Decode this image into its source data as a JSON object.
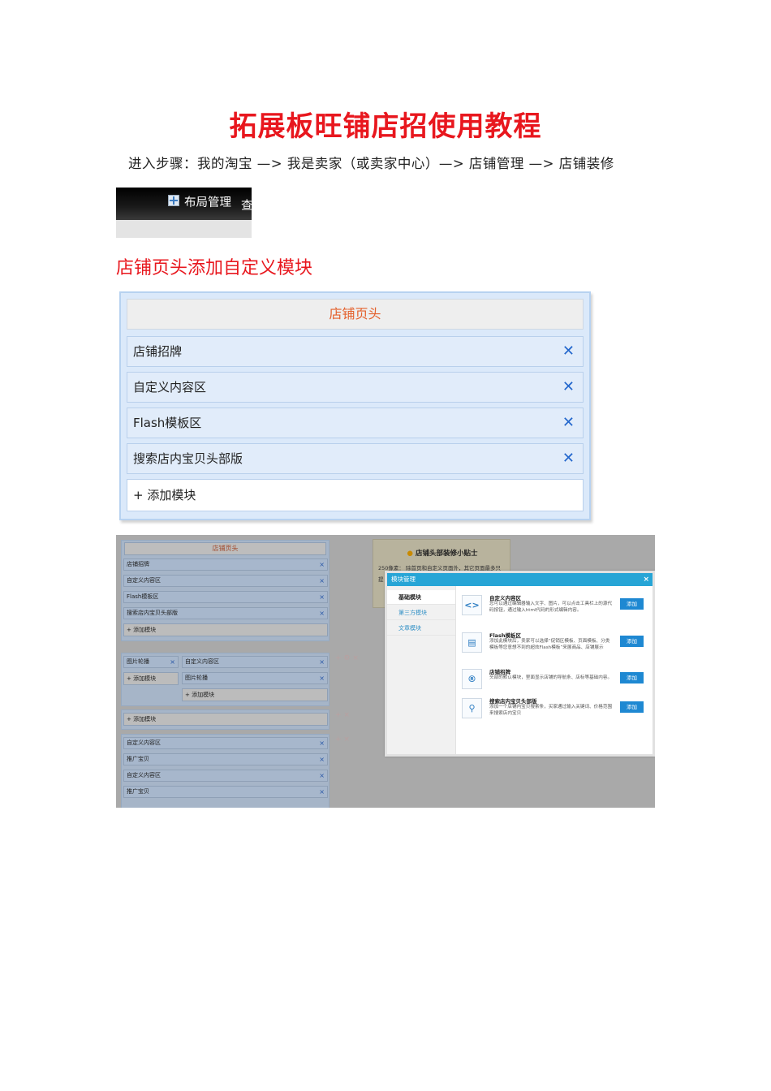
{
  "doc_title": "拓展板旺铺店招使用教程",
  "steps": "进入步骤：我的淘宝 —> 我是卖家（或卖家中心）—> 店铺管理 —> 店铺装修",
  "toolbar": {
    "layout_label": "布局管理",
    "cut_label": "查"
  },
  "section_heading": "店铺页头添加自定义模块",
  "panel": {
    "header": "店铺页头",
    "rows": [
      "店铺招牌",
      "自定义内容区",
      "Flash模板区",
      "搜索店内宝贝头部版"
    ],
    "remove_symbol": "✕",
    "add_label": "+ 添加模块"
  },
  "screenshot": {
    "header": "店铺页头",
    "rows": [
      "店铺招牌",
      "自定义内容区",
      "Flash模板区",
      "搜索店内宝贝头部版"
    ],
    "add_label": "+ 添加模块",
    "remove_symbol": "×",
    "mid_left_row": "图片轮播",
    "mid_right_rows": [
      "自定义内容区",
      "图片轮播"
    ],
    "lower_rows": [
      "自定义内容区",
      "推广宝贝",
      "自定义内容区",
      "推广宝贝"
    ],
    "tip_title": "店铺头部装修小贴士",
    "tip_body": "250像素： 除首页和自定义页面外，其它页面最多只",
    "tip_cut": "提",
    "modal": {
      "title": "模块管理",
      "close": "×",
      "tabs": [
        "基础模块",
        "第三方模块",
        "文章模块"
      ],
      "add_label": "添加",
      "items": [
        {
          "title": "自定义内容区",
          "desc": "您可以通过编辑器输入文字、图片，可以点击工具栏上的源代码按钮，通过输入html代码的形式编辑内容。",
          "icon": "code-icon"
        },
        {
          "title": "Flash模板区",
          "desc": "添加此模块后，卖家可以选择“促销区模板、页面模板、分类模板等您意想不到的超炫Flash模板”来展商品、店铺展示",
          "icon": "layout-template-icon"
        },
        {
          "title": "店铺招牌",
          "desc": "头部的默认模块，里面显示店铺的导航条、店标等基础内容。",
          "icon": "registered-icon"
        },
        {
          "title": "搜索店内宝贝头部版",
          "desc": "添加一个店铺内宝贝搜索条，买家通过输入关键词、价格范围来搜索店内宝贝",
          "icon": "search-icon"
        }
      ]
    }
  }
}
